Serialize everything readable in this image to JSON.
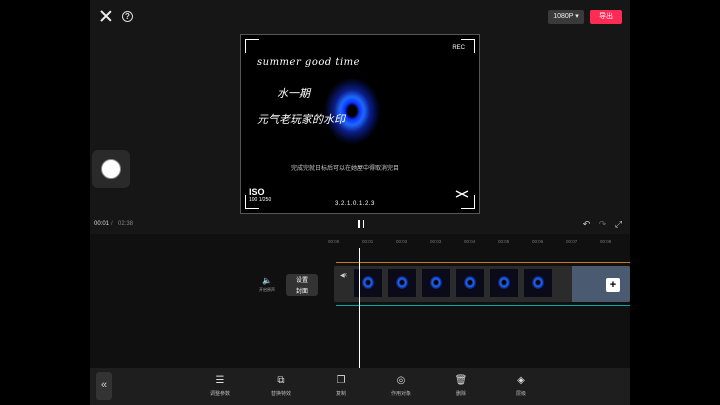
{
  "topbar": {
    "resolution": "1080P ▾",
    "export_label": "导出"
  },
  "preview": {
    "rec_label": "REC",
    "script_title": "summer good time",
    "line1": "水一期",
    "line2": "元气老玩家的水印",
    "subtitle": "完成完就日标后可以在她屋中得取消完目",
    "iso_big": "ISO",
    "iso_small": "100  1/250",
    "timecode": "3.2.1.0.1.2.3"
  },
  "playback": {
    "current_time": "00:01",
    "separator": "/",
    "total_time": "02:38"
  },
  "timeline": {
    "ruler": [
      "00:00",
      "00:01",
      "00:02",
      "00:03",
      "00:04",
      "00:05",
      "00:06",
      "00:07",
      "00:08"
    ],
    "mute_label": "开启原声",
    "cover_label_1": "设置",
    "cover_label_2": "封面",
    "add_label": "+"
  },
  "toolbar": {
    "collapse_label": "«",
    "items": [
      {
        "label": "调整参数",
        "icon": "adjust-icon"
      },
      {
        "label": "替换特效",
        "icon": "replace-effect-icon"
      },
      {
        "label": "复制",
        "icon": "copy-icon"
      },
      {
        "label": "作用对象",
        "icon": "target-object-icon"
      },
      {
        "label": "删除",
        "icon": "delete-icon"
      },
      {
        "label": "层级",
        "icon": "layers-icon"
      }
    ]
  }
}
